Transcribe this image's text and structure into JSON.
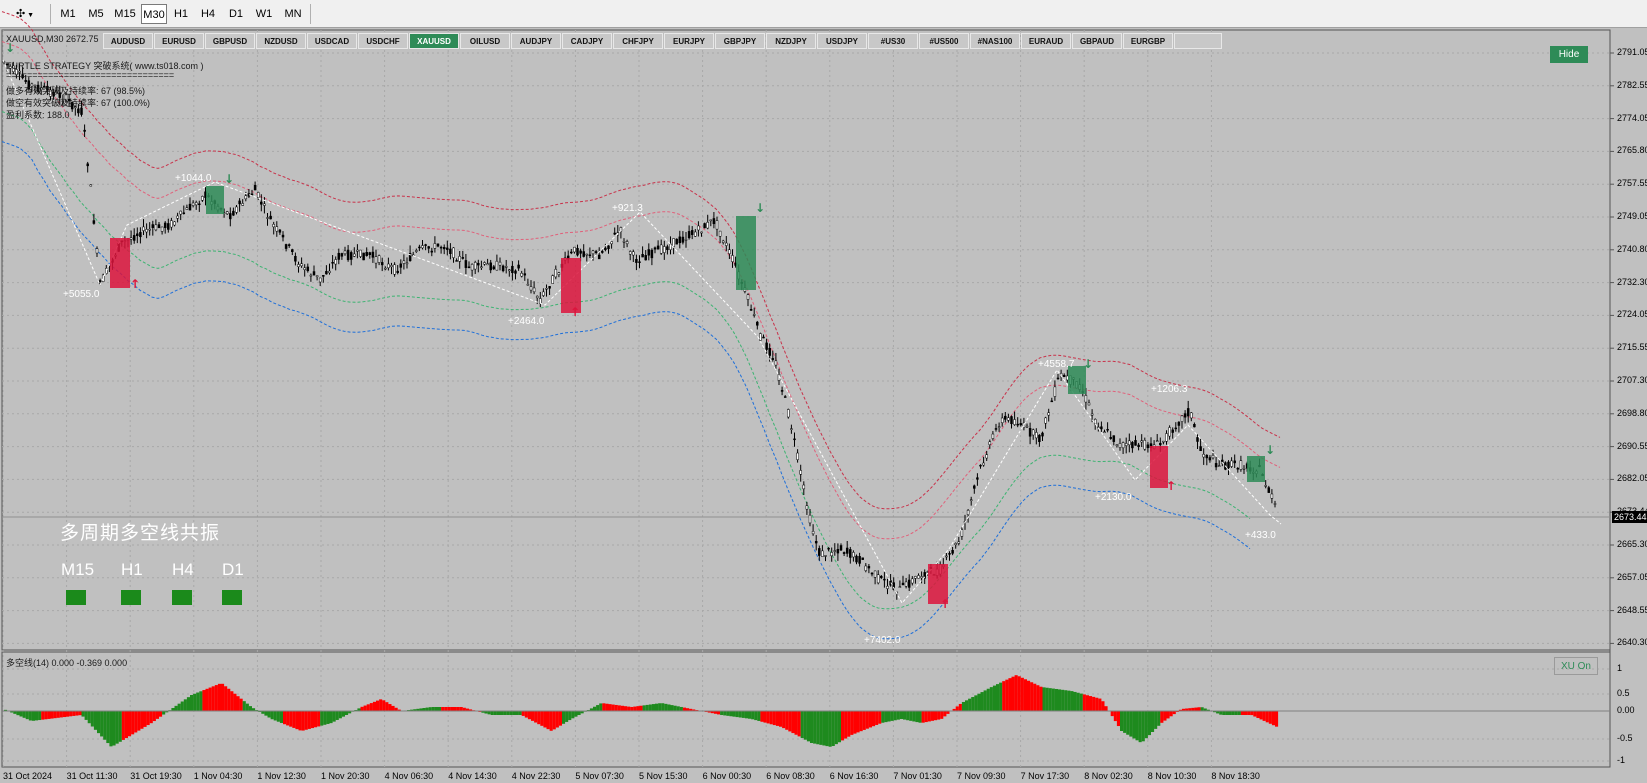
{
  "toolbar": {
    "timeframes": [
      "M1",
      "M5",
      "M15",
      "M30",
      "H1",
      "H4",
      "D1",
      "W1",
      "MN"
    ],
    "active_timeframe": "M30"
  },
  "symbol_tabs": [
    "AUDUSD",
    "EURUSD",
    "GBPUSD",
    "NZDUSD",
    "USDCAD",
    "USDCHF",
    "XAUUSD",
    "OILUSD",
    "AUDJPY",
    "CADJPY",
    "CHFJPY",
    "EURJPY",
    "GBPJPY",
    "NZDJPY",
    "USDJPY",
    "#US30",
    "#US500",
    "#NAS100",
    "EURAUD",
    "GBPAUD",
    "EURGBP"
  ],
  "active_symbol": "XAUUSD",
  "header": {
    "symbol_info": "XAUUSD,M30  2672.75",
    "strategy_line": "TURTLE STRATEGY 突破系统(  www.ts018.com  )",
    "separator": "================================",
    "stat1": "做多有效突破及持续率: 67 (98.5%)",
    "stat2": "做空有效突破及持续率: 67 (100.0%)",
    "stat3": "盈利系数: 188.0"
  },
  "hide_button": "Hide",
  "xu_button": "XU On",
  "mtf": {
    "title": "多周期多空线共振",
    "periods": [
      "M15",
      "H1",
      "H4",
      "D1"
    ],
    "status_color": "#1b8a1b"
  },
  "price_axis": [
    "2791.05",
    "2782.55",
    "2774.05",
    "2765.80",
    "2757.55",
    "2749.05",
    "2740.80",
    "2732.30",
    "2724.05",
    "2715.55",
    "2707.30",
    "2698.80",
    "2690.55",
    "2682.05",
    "2673.44",
    "2665.30",
    "2657.05",
    "2648.55",
    "2640.30"
  ],
  "current_price": "2673.44",
  "indicator": {
    "title": "多空线(14) 0.000 -0.369 0.000",
    "axis": [
      "1",
      "0.5",
      "0.00",
      "-0.5",
      "-1"
    ]
  },
  "date_axis": [
    "31 Oct 2024",
    "31 Oct 11:30",
    "31 Oct 19:30",
    "1 Nov 04:30",
    "1 Nov 12:30",
    "1 Nov 20:30",
    "4 Nov 06:30",
    "4 Nov 14:30",
    "4 Nov 22:30",
    "5 Nov 07:30",
    "5 Nov 15:30",
    "6 Nov 00:30",
    "6 Nov 08:30",
    "6 Nov 16:30",
    "7 Nov 01:30",
    "7 Nov 09:30",
    "7 Nov 17:30",
    "8 Nov 02:30",
    "8 Nov 10:30",
    "8 Nov 18:30"
  ],
  "trade_labels": [
    "+5055.0",
    "+1044.0",
    "+2464.0",
    "+921.3",
    "+7402.0",
    "+4558.7",
    "+2130.0",
    "+1206.3",
    "+433.0"
  ],
  "colors": {
    "bull": "#2e8b57",
    "bear": "#dc143c",
    "background": "#c0c0c0",
    "hist_green": "#1e8a1e",
    "hist_red": "#ff0000"
  }
}
